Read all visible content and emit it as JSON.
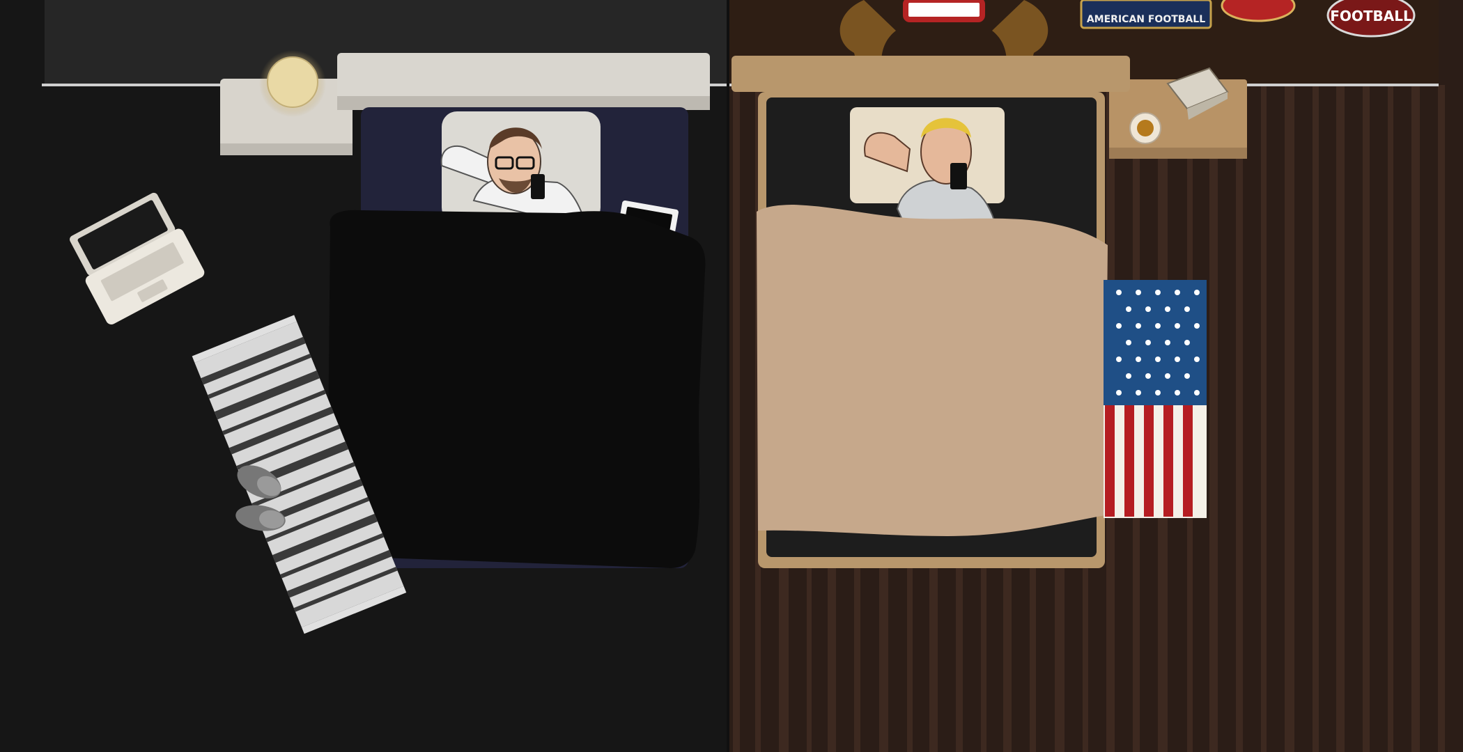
{
  "scene": {
    "left_room": {
      "theme": "minimal-dark"
    },
    "right_room": {
      "theme": "american-sports"
    }
  },
  "colors": {
    "left_floor": "#161616",
    "left_wall": "#262626",
    "left_bed_frame": "#d9d6cf",
    "left_sheet": "#22233a",
    "left_blanket": "#0c0c0c",
    "right_floor_dark": "#2b1d17",
    "right_floor_light": "#4c3328",
    "right_wall": "#2e1e14",
    "right_bed_frame": "#b8976c",
    "right_blanket": "#c6a88b",
    "flag_red": "#b51d22",
    "flag_blue": "#1f4f86"
  },
  "wall_logos": {
    "left_banner_text": "AMERICAN FOOTBALL",
    "right_logo_text": "FOOTBALL"
  },
  "icons": {
    "lamp": "table-lamp",
    "laptop": "laptop",
    "tablet": "tablet",
    "phone": "smartphone",
    "slippers": "slippers",
    "moose": "moose-antlers",
    "flag": "us-flag-rug",
    "coffee": "coffee-cup",
    "box": "open-box"
  }
}
